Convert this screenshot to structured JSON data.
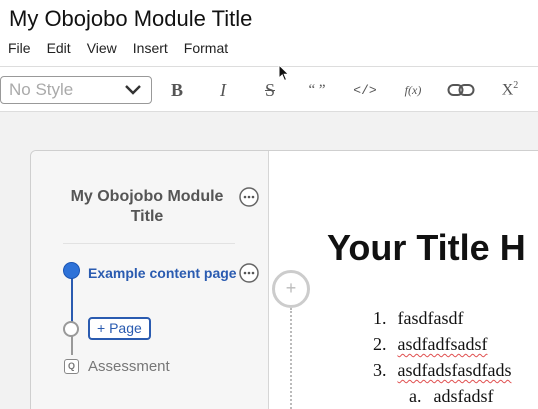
{
  "window": {
    "title": "My Obojobo Module Title"
  },
  "menu": [
    "File",
    "Edit",
    "View",
    "Insert",
    "Format"
  ],
  "toolbar": {
    "style_select": {
      "value": "No Style"
    },
    "tools": [
      {
        "name": "bold-icon",
        "label": "B"
      },
      {
        "name": "italic-icon",
        "label": "I"
      },
      {
        "name": "strikethrough-icon",
        "label": "S"
      },
      {
        "name": "quote-icon",
        "label": "“ ”"
      },
      {
        "name": "code-icon",
        "label": "</>"
      },
      {
        "name": "formula-icon",
        "label": "f(x)"
      },
      {
        "name": "link-icon",
        "label": ""
      },
      {
        "name": "superscript-icon",
        "label": "X2"
      }
    ]
  },
  "nav": {
    "title": "My Obojobo Module Title",
    "pages": [
      {
        "label": "Example content page",
        "active": true
      }
    ],
    "add_page_label": "+ Page",
    "assessment": {
      "icon_letter": "Q",
      "label": "Assessment"
    }
  },
  "content": {
    "heading": "Your Title H",
    "list": [
      {
        "num": "1.",
        "text": "fasdfasdf",
        "spell_error": false
      },
      {
        "num": "2.",
        "text": "asdfadfsadsf",
        "spell_error": true
      },
      {
        "num": "3.",
        "text": "asdfadsfasdfads",
        "spell_error": true
      },
      {
        "num": "a.",
        "text": "adsfadsf",
        "spell_error": false,
        "sub": true
      }
    ],
    "add_button_label": "+"
  },
  "colors": {
    "accent": "#2a5bb0",
    "active_dot": "#2e72d8",
    "spell_error": "#e05050"
  }
}
